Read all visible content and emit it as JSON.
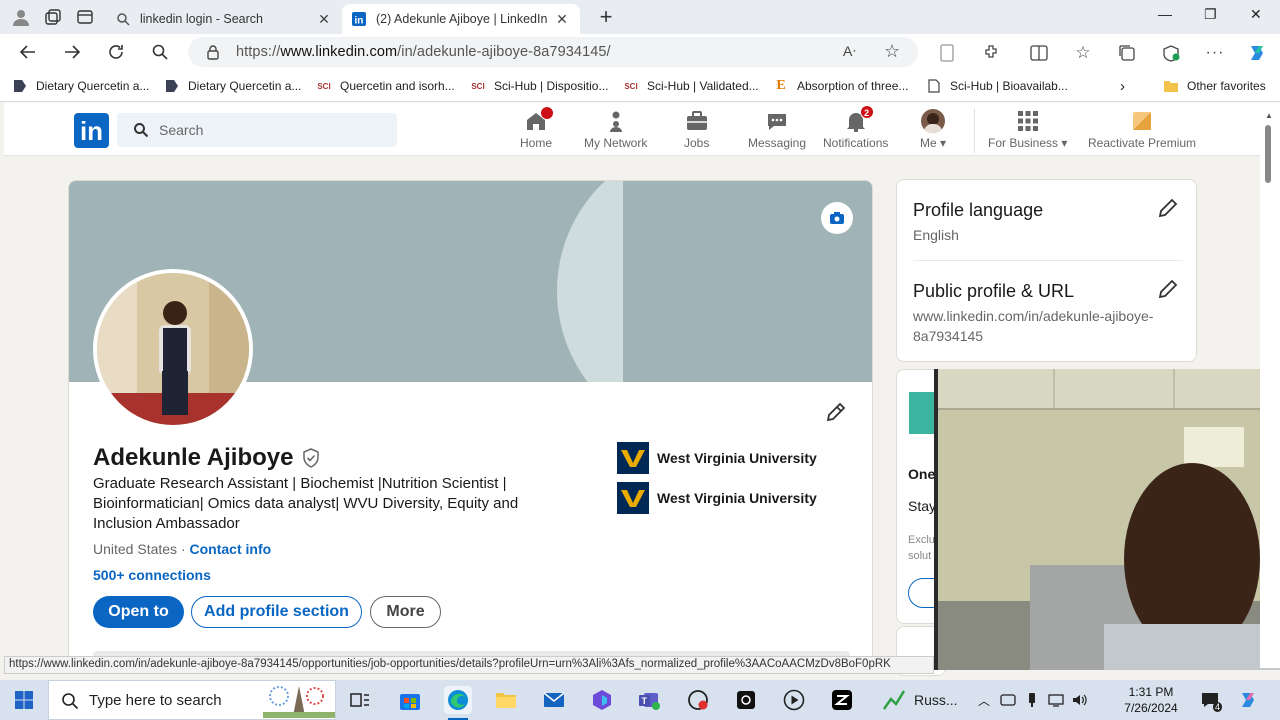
{
  "browser": {
    "tabs": [
      {
        "title": "linkedin login - Search",
        "active": false
      },
      {
        "title": "(2) Adekunle Ajiboye | LinkedIn",
        "active": true
      }
    ],
    "url_prefix": "https://",
    "url_host": "www.linkedin.com",
    "url_path": "/in/adekunle-ajiboye-8a7934145/",
    "favorites": [
      {
        "label": "Dietary Quercetin a...",
        "icon": "bookmark-dark"
      },
      {
        "label": "Dietary Quercetin a...",
        "icon": "bookmark-dark"
      },
      {
        "label": "Quercetin and isorh...",
        "icon": "scihub"
      },
      {
        "label": "Sci-Hub | Dispositio...",
        "icon": "scihub"
      },
      {
        "label": "Sci-Hub | Validated...",
        "icon": "scihub"
      },
      {
        "label": "Absorption of three...",
        "icon": "e-logo"
      },
      {
        "label": "Sci-Hub | Bioavailab...",
        "icon": "page"
      }
    ],
    "other_favorites": "Other favorites",
    "status_url": "https://www.linkedin.com/in/adekunle-ajiboye-8a7934145/opportunities/job-opportunities/details?profileUrn=urn%3Ali%3Afs_normalized_profile%3AACoAACMzDv8BoF0pRK"
  },
  "linkedin": {
    "search_placeholder": "Search",
    "nav": {
      "home": "Home",
      "network": "My Network",
      "jobs": "Jobs",
      "messaging": "Messaging",
      "notifications": "Notifications",
      "notifications_count": "2",
      "me": "Me",
      "business": "For Business",
      "premium": "Reactivate Premium"
    },
    "profile": {
      "name": "Adekunle Ajiboye",
      "headline": "Graduate Research Assistant | Biochemist |Nutrition Scientist | Bioinformatician| Omics data analyst| WVU Diversity, Equity and Inclusion Ambassador",
      "location": "United States",
      "separator": " · ",
      "contact_info": "Contact info",
      "connections": "500+ connections",
      "buttons": {
        "open_to": "Open to",
        "add_section": "Add profile section",
        "more": "More"
      },
      "education": [
        "West Virginia University",
        "West Virginia University"
      ]
    },
    "sidebar": {
      "language_title": "Profile language",
      "language_value": "English",
      "public_title": "Public profile & URL",
      "public_url": "www.linkedin.com/in/adekunle-ajiboye-8a7934145",
      "partial_1": "One",
      "partial_2": "Stay",
      "partial_3": "Exclu",
      "partial_4": "solut"
    }
  },
  "taskbar": {
    "search_placeholder": "Type here to search",
    "running_label": "Russ...",
    "time": "1:31 PM",
    "date": "7/26/2024",
    "notif_count": "4"
  },
  "colors": {
    "linkedin_blue": "#0a66c2",
    "badge_red": "#cc1016",
    "wvu_navy": "#002855",
    "wvu_gold": "#eaaa00"
  }
}
